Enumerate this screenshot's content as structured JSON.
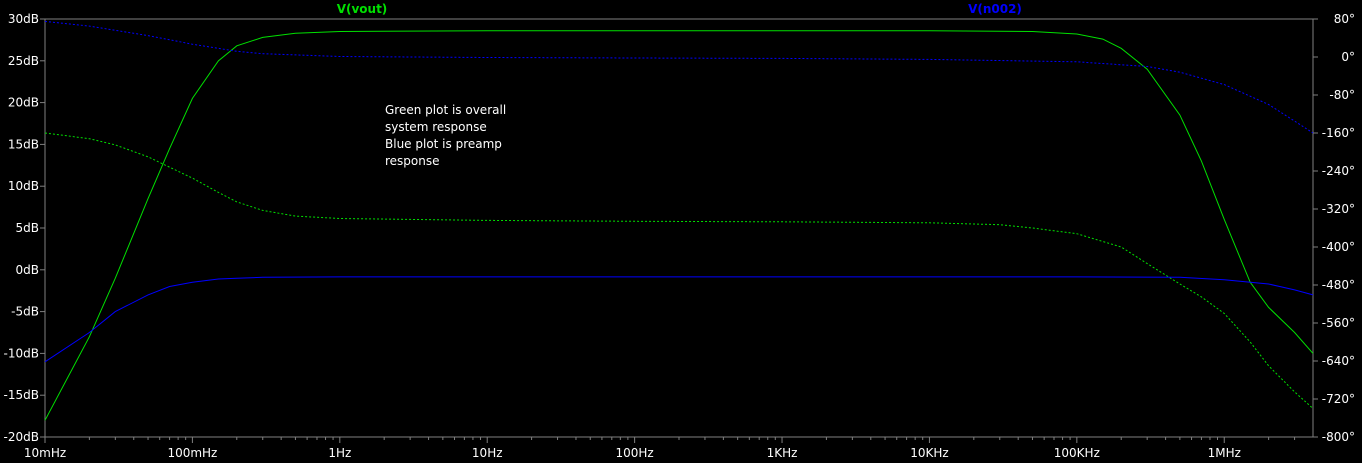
{
  "chart_data": {
    "type": "line",
    "x_scale": "log",
    "x_ticks": [
      {
        "value": 0.01,
        "label": "10mHz"
      },
      {
        "value": 0.1,
        "label": "100mHz"
      },
      {
        "value": 1,
        "label": "1Hz"
      },
      {
        "value": 10,
        "label": "10Hz"
      },
      {
        "value": 100,
        "label": "100Hz"
      },
      {
        "value": 1000,
        "label": "1KHz"
      },
      {
        "value": 10000,
        "label": "10KHz"
      },
      {
        "value": 100000,
        "label": "100KHz"
      },
      {
        "value": 1000000,
        "label": "1MHz"
      }
    ],
    "xlim": [
      0.01,
      4000000
    ],
    "y_left": {
      "unit": "dB",
      "ylim": [
        -20,
        30
      ],
      "ticks": [
        {
          "value": 30,
          "label": "30dB"
        },
        {
          "value": 25,
          "label": "25dB"
        },
        {
          "value": 20,
          "label": "20dB"
        },
        {
          "value": 15,
          "label": "15dB"
        },
        {
          "value": 10,
          "label": "10dB"
        },
        {
          "value": 5,
          "label": "5dB"
        },
        {
          "value": 0,
          "label": "0dB"
        },
        {
          "value": -5,
          "label": "-5dB"
        },
        {
          "value": -10,
          "label": "-10dB"
        },
        {
          "value": -15,
          "label": "-15dB"
        },
        {
          "value": -20,
          "label": "-20dB"
        }
      ]
    },
    "y_right": {
      "unit": "°",
      "ylim": [
        -800,
        80
      ],
      "ticks": [
        {
          "value": 80,
          "label": "80°"
        },
        {
          "value": 0,
          "label": "0°"
        },
        {
          "value": -80,
          "label": "-80°"
        },
        {
          "value": -160,
          "label": "-160°"
        },
        {
          "value": -240,
          "label": "-240°"
        },
        {
          "value": -320,
          "label": "-320°"
        },
        {
          "value": -400,
          "label": "-400°"
        },
        {
          "value": -480,
          "label": "-480°"
        },
        {
          "value": -560,
          "label": "-560°"
        },
        {
          "value": -640,
          "label": "-640°"
        },
        {
          "value": -720,
          "label": "-720°"
        },
        {
          "value": -800,
          "label": "-800°"
        }
      ]
    },
    "grid": false,
    "series": [
      {
        "name": "V(vout)",
        "color": "#00e000",
        "magnitude_db": [
          [
            0.01,
            -18
          ],
          [
            0.02,
            -8
          ],
          [
            0.03,
            -1
          ],
          [
            0.05,
            8.5
          ],
          [
            0.07,
            14.5
          ],
          [
            0.1,
            20.5
          ],
          [
            0.15,
            25
          ],
          [
            0.2,
            26.8
          ],
          [
            0.3,
            27.8
          ],
          [
            0.5,
            28.3
          ],
          [
            1,
            28.5
          ],
          [
            10,
            28.6
          ],
          [
            100,
            28.6
          ],
          [
            1000,
            28.6
          ],
          [
            10000,
            28.6
          ],
          [
            50000,
            28.5
          ],
          [
            100000,
            28.2
          ],
          [
            150000,
            27.6
          ],
          [
            200000,
            26.5
          ],
          [
            300000,
            24
          ],
          [
            500000,
            18.5
          ],
          [
            700000,
            13
          ],
          [
            1000000,
            6
          ],
          [
            1500000,
            -1.5
          ],
          [
            2000000,
            -4.5
          ],
          [
            3000000,
            -7.5
          ],
          [
            4000000,
            -10
          ]
        ],
        "phase_deg": [
          [
            0.01,
            -160
          ],
          [
            0.02,
            -172
          ],
          [
            0.03,
            -185
          ],
          [
            0.05,
            -210
          ],
          [
            0.07,
            -232
          ],
          [
            0.1,
            -255
          ],
          [
            0.15,
            -285
          ],
          [
            0.2,
            -305
          ],
          [
            0.3,
            -323
          ],
          [
            0.5,
            -335
          ],
          [
            1,
            -340
          ],
          [
            10,
            -344
          ],
          [
            100,
            -346
          ],
          [
            1000,
            -347
          ],
          [
            10000,
            -349
          ],
          [
            30000,
            -353
          ],
          [
            50000,
            -360
          ],
          [
            100000,
            -372
          ],
          [
            200000,
            -400
          ],
          [
            300000,
            -435
          ],
          [
            500000,
            -478
          ],
          [
            700000,
            -505
          ],
          [
            1000000,
            -540
          ],
          [
            1500000,
            -600
          ],
          [
            2000000,
            -650
          ],
          [
            3000000,
            -705
          ],
          [
            4000000,
            -740
          ]
        ]
      },
      {
        "name": "V(n002)",
        "color": "#0000ff",
        "magnitude_db": [
          [
            0.01,
            -11
          ],
          [
            0.02,
            -7.5
          ],
          [
            0.03,
            -5
          ],
          [
            0.05,
            -3
          ],
          [
            0.07,
            -2
          ],
          [
            0.1,
            -1.5
          ],
          [
            0.15,
            -1.1
          ],
          [
            0.2,
            -1
          ],
          [
            0.3,
            -0.9
          ],
          [
            1,
            -0.85
          ],
          [
            10,
            -0.85
          ],
          [
            100,
            -0.85
          ],
          [
            1000,
            -0.85
          ],
          [
            10000,
            -0.85
          ],
          [
            100000,
            -0.85
          ],
          [
            500000,
            -0.9
          ],
          [
            1000000,
            -1.2
          ],
          [
            2000000,
            -1.7
          ],
          [
            3000000,
            -2.4
          ],
          [
            4000000,
            -3
          ]
        ],
        "phase_deg": [
          [
            0.01,
            75
          ],
          [
            0.02,
            65
          ],
          [
            0.05,
            45
          ],
          [
            0.1,
            27
          ],
          [
            0.2,
            12
          ],
          [
            0.3,
            7
          ],
          [
            1,
            1
          ],
          [
            10,
            -1
          ],
          [
            100,
            -2
          ],
          [
            1000,
            -3
          ],
          [
            10000,
            -5
          ],
          [
            100000,
            -10
          ],
          [
            300000,
            -20
          ],
          [
            500000,
            -32
          ],
          [
            1000000,
            -58
          ],
          [
            2000000,
            -100
          ],
          [
            3000000,
            -135
          ],
          [
            4000000,
            -160
          ]
        ]
      }
    ],
    "annotation": "Green plot is overall\nsystem response\nBlue plot is preamp\nresponse"
  },
  "style": {
    "background": "#000000",
    "axis_color": "#808080",
    "text_color": "#ffffff"
  }
}
